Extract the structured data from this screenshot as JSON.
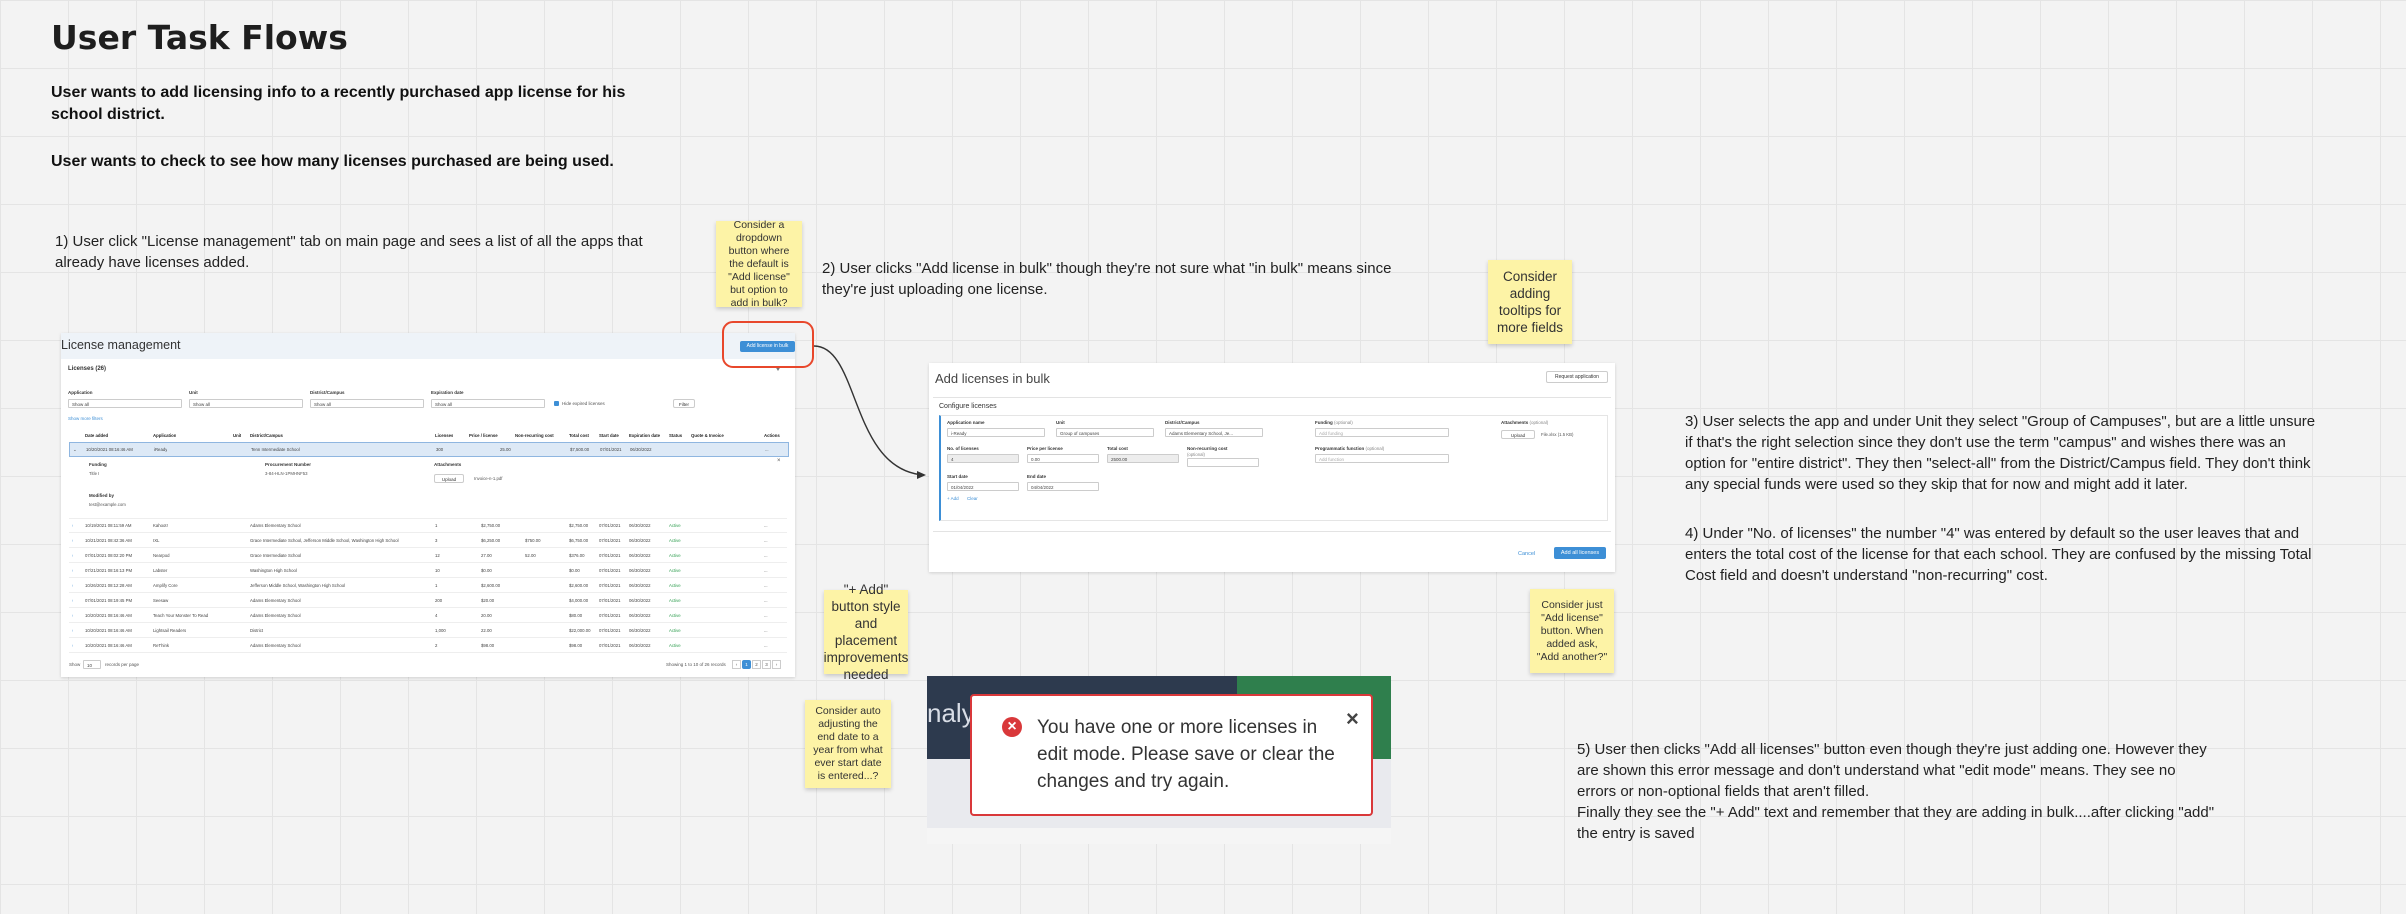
{
  "title": "User Task Flows",
  "goals": [
    "User wants to add licensing info to a recently purchased app license for his school district.",
    "User wants to check to see how many licenses purchased are being used."
  ],
  "steps": {
    "s1": "1) User click \"License management\" tab on main page and sees a list of all the apps that already have licenses added.",
    "s2": "2) User clicks \"Add license in bulk\" though they're not sure what \"in bulk\" means since they're just uploading one license.",
    "s3": "3) User selects the app and under Unit they select \"Group of Campuses\", but are a little unsure if that's the right selection since they don't use the term \"campus\" and wishes there was an option for \"entire district\". They then \"select-all\" from the District/Campus field. They don't think any special funds were used so they skip that for now and might add it later.",
    "s4": "4) Under \"No. of licenses\" the number \"4\" was entered by default so the user leaves that and enters the total cost of the license for that each school. They are confused by the missing Total Cost field and doesn't understand \"non-recurring\" cost.",
    "s5": "5) User then clicks \"Add all licenses\" button even though they're just adding one. However they are shown this error message and don't understand what \"edit mode\" means. They see no errors or non-optional fields that aren't filled.\nFinally they see the \"+ Add\" text and remember that they are adding in bulk....after clicking \"add\" the entry is saved"
  },
  "stickies": {
    "dropdown": "Consider a dropdown button where the default is \"Add license\" but option to add in bulk?",
    "tooltips": "Consider adding tooltips for more fields",
    "add_button": "\"+ Add\" button style and placement improvements needed",
    "end_date": "Consider auto adjusting the end date to a year from what ever start date is entered...?",
    "add_license": "Consider just \"Add license\" button. When added ask, \"Add another?\""
  },
  "license_mgmt": {
    "title": "License management",
    "add_bulk_btn": "Add license in bulk",
    "count_label": "Licenses (26)",
    "filters": [
      {
        "label": "Application",
        "value": "Show all"
      },
      {
        "label": "Unit",
        "value": "Show all"
      },
      {
        "label": "District/Campus",
        "value": "Show all"
      },
      {
        "label": "Expiration date",
        "value": "Show all"
      }
    ],
    "hide_expired": "Hide expired licenses",
    "filter_btn": "Filter",
    "show_more": "Show more filters",
    "columns": [
      "Date added",
      "Application",
      "Unit",
      "District/Campus",
      "Licenses",
      "Price / license",
      "Non-recurring cost",
      "Total cost",
      "Start date",
      "Expiration date",
      "Status",
      "Quote & Invoice",
      "Actions"
    ],
    "expanded_row": [
      "10/20/2021 08:16:46 AM",
      "iReady",
      "",
      "Tenn Intermediate School",
      "300",
      "25.00",
      "",
      "$7,500.00",
      "07/01/2021",
      "06/30/2022",
      "",
      "",
      "..."
    ],
    "expanded_detail": {
      "funding_label": "Funding",
      "funding_value": "Title I",
      "proc_label": "Procurement Number",
      "proc_value": "3-84-HLN-1PMHNF53",
      "attach_label": "Attachments",
      "attach_btn": "Upload",
      "attach_value": "Invoice-n-1.pdf",
      "modified_label": "Modified by",
      "modified_value": "test@example.com"
    },
    "rows": [
      [
        "10/19/2021 08:11:59 AM",
        "Kahoot!",
        "",
        "Adams Elementary School",
        "1",
        "$2,750.00",
        "",
        "$2,750.00",
        "07/01/2021",
        "06/30/2022",
        "Active",
        "",
        "..."
      ],
      [
        "10/21/2021 08:42:36 AM",
        "IXL",
        "",
        "Grace Intermediate School, Jefferson Middle School, Washington High School",
        "3",
        "$6,250.00",
        "$750.00",
        "$6,750.00",
        "07/01/2021",
        "06/30/2022",
        "Active",
        "",
        "..."
      ],
      [
        "07/01/2021 08:02:20 PM",
        "Nearpod",
        "",
        "Grace Intermediate School",
        "12",
        "27.00",
        "52.00",
        "$376.00",
        "07/01/2021",
        "06/30/2022",
        "Active",
        "",
        "..."
      ],
      [
        "07/21/2021 08:16:13 PM",
        "Labster",
        "",
        "Washington High School",
        "10",
        "$0.00",
        "",
        "$0.00",
        "07/01/2021",
        "06/30/2022",
        "Active",
        "",
        "..."
      ],
      [
        "10/26/2021 08:12:28 AM",
        "Amplify Core",
        "",
        "Jefferson Middle School, Washington High School",
        "1",
        "$2,600.00",
        "",
        "$2,600.00",
        "07/01/2021",
        "06/30/2022",
        "Active",
        "",
        "..."
      ],
      [
        "07/01/2021 08:19:45 PM",
        "Seesaw",
        "",
        "Adams Elementary School",
        "200",
        "$20.00",
        "",
        "$4,000.00",
        "07/01/2021",
        "06/30/2022",
        "Active",
        "",
        "..."
      ],
      [
        "10/20/2021 08:16:46 AM",
        "Teach Your Monster To Read",
        "",
        "Adams Elementary School",
        "4",
        "20.00",
        "",
        "$80.00",
        "07/01/2021",
        "06/30/2022",
        "Active",
        "",
        "..."
      ],
      [
        "10/20/2021 08:16:46 AM",
        "Lightsail Readers",
        "",
        "District",
        "1,000",
        "22.00",
        "",
        "$22,000.00",
        "07/01/2021",
        "06/30/2022",
        "Active",
        "",
        "..."
      ],
      [
        "10/20/2021 08:16:46 AM",
        "ReThink",
        "",
        "Adams Elementary School",
        "2",
        "$98.00",
        "",
        "$98.00",
        "07/01/2021",
        "06/30/2022",
        "Active",
        "",
        "..."
      ]
    ],
    "footer_show": "Show",
    "footer_count": "10",
    "footer_suffix": "records per page",
    "footer_range": "Showing 1 to 10 of 26 records",
    "pages": [
      "1",
      "2",
      "3"
    ]
  },
  "bulk_form": {
    "title": "Add licenses in bulk",
    "request_btn": "Request application",
    "section": "Configure licenses",
    "app_label": "Application name",
    "app_value": "i-Ready",
    "unit_label": "Unit",
    "unit_value": "Group of campuses",
    "campus_label": "District/Campus",
    "campus_value": "Adams Elementary School, Je...",
    "funding_label": "Funding",
    "funding_opt": "(optional)",
    "funding_ph": "Add funding",
    "attach_label": "Attachments",
    "attach_opt": "(optional)",
    "attach_btn": "Upload",
    "attach_file": "File.xlsx (1.5 KB)",
    "nol_label": "No. of licenses",
    "nol_value": "4",
    "ppl_label": "Price per license",
    "ppl_value": "0.00",
    "tc_label": "Total cost",
    "tc_value": "2500.00",
    "nrc_label": "Non-recurring cost",
    "nrc_opt": "(optional)",
    "proc_label": "Programmatic function",
    "proc_opt": "(optional)",
    "proc_ph": "Add function",
    "start_label": "Start date",
    "start_value": "01/04/2022",
    "end_label": "End date",
    "end_value": "04/04/2022",
    "add_link": "+ Add",
    "clear_link": "Clear",
    "cancel_btn": "Cancel",
    "submit_btn": "Add all licenses"
  },
  "error": {
    "message": "You have one or more licenses in edit mode. Please save or clear the changes and try again.",
    "bg_text": "nalyt"
  },
  "colors": {
    "sticky": "#fdf3a6",
    "highlight": "#e8472b",
    "primary": "#3d8fd6",
    "error": "#d9383a"
  }
}
